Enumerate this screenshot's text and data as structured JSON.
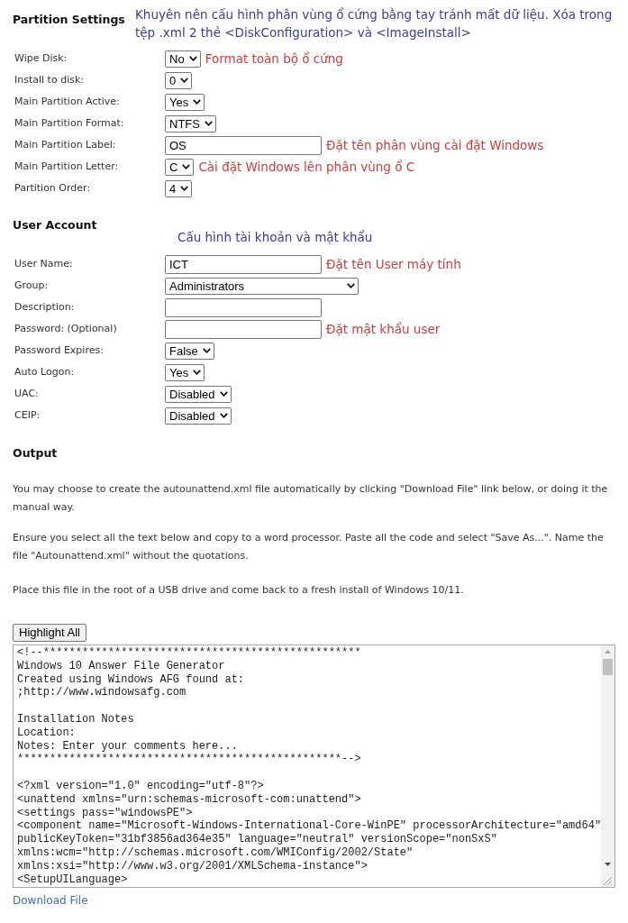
{
  "partition_settings": {
    "heading": "Partition Settings",
    "note": "Khuyên nên cấu hình phân vùng ổ cứng bằng tay tránh mất dữ liệu.  Xóa trong tệp .xml 2 thẻ <DiskConfiguration> và <ImageInstall>",
    "fields": [
      {
        "label": "Wipe Disk:",
        "kind": "select",
        "value": "No",
        "annotation": "Format toàn bộ ổ cứng"
      },
      {
        "label": "Install to disk:",
        "kind": "select",
        "value": "0"
      },
      {
        "label": "Main Partition Active:",
        "kind": "select",
        "value": "Yes"
      },
      {
        "label": "Main Partition Format:",
        "kind": "select",
        "value": "NTFS"
      },
      {
        "label": "Main Partition Label:",
        "kind": "text",
        "value": "OS",
        "annotation": "Đặt tên phân vùng cài đặt Windows"
      },
      {
        "label": "Main Partition Letter:",
        "kind": "select",
        "value": "C",
        "annotation": "Cài đặt Windows lên phân vùng ổ C"
      },
      {
        "label": "Partition Order:",
        "kind": "select",
        "value": "4"
      }
    ]
  },
  "user_account": {
    "heading": "User Account",
    "note": "Cấu hình tài khoản và mật khẩu",
    "fields": [
      {
        "label": "User Name:",
        "kind": "text",
        "value": "ICT",
        "annotation": "Đặt tên User máy tính"
      },
      {
        "label": "Group:",
        "kind": "select",
        "value": "Administrators"
      },
      {
        "label": "Description:",
        "kind": "text"
      },
      {
        "label": "Password: (Optional)",
        "kind": "text",
        "annotation": "Đặt mật khẩu user"
      },
      {
        "label": "Password Expires:",
        "kind": "select",
        "value": "False"
      },
      {
        "label": "Auto Logon:",
        "kind": "select",
        "value": "Yes"
      },
      {
        "label": "UAC:",
        "kind": "select",
        "value": "Disabled"
      },
      {
        "label": "CEIP:",
        "kind": "select",
        "value": "Disabled"
      }
    ]
  },
  "output": {
    "heading": "Output",
    "paragraphs": [
      "You may choose to create the autounattend.xml file automatically by clicking \"Download File\" link below, or doing it the manual way.",
      "Ensure you select all the text below and copy to a word processor. Paste all the code and select \"Save As...\". Name the file \"Autounattend.xml\" without the quotations.",
      "Place this file in the root of a USB drive and come back to a fresh install of Windows 10/11."
    ],
    "highlight_button": "Highlight All",
    "code": "<!--*************************************************\nWindows 10 Answer File Generator\nCreated using Windows AFG found at:\n;http://www.windowsafg.com\n\nInstallation Notes\nLocation:\nNotes: Enter your comments here...\n**************************************************-->\n\n<?xml version=\"1.0\" encoding=\"utf-8\"?>\n<unattend xmlns=\"urn:schemas-microsoft-com:unattend\">\n<settings pass=\"windowsPE\">\n<component name=\"Microsoft-Windows-International-Core-WinPE\" processorArchitecture=\"amd64\"\npublicKeyToken=\"31bf3856ad364e35\" language=\"neutral\" versionScope=\"nonSxS\"\nxmlns:wcm=\"http://schemas.microsoft.com/WMIConfig/2002/State\"\nxmlns:xsi=\"http://www.w3.org/2001/XMLSchema-instance\">\n<SetupUILanguage>",
    "download_link": "Download File"
  }
}
